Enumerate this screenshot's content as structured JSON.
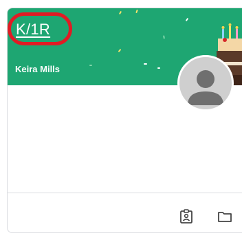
{
  "class_card": {
    "title": "K/1R",
    "teacher_name": "Keira Mills",
    "header_color": "#1ea672",
    "highlight_color": "#e01b24"
  },
  "footer": {
    "icons": [
      "assignment-ind-icon",
      "folder-icon"
    ]
  }
}
